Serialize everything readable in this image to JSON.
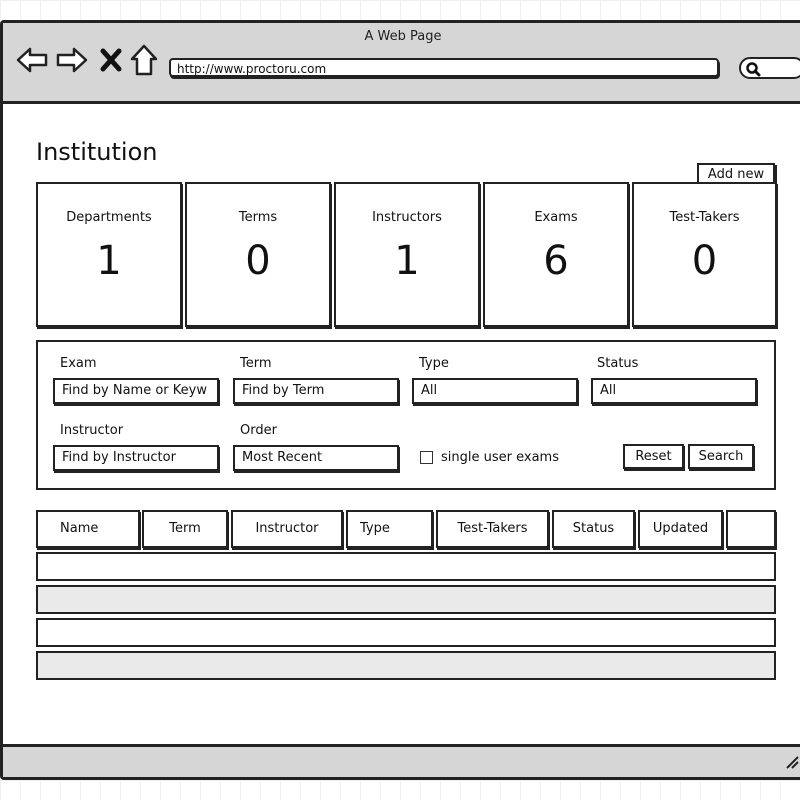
{
  "window": {
    "title": "A Web Page",
    "url": "http://www.proctoru.com"
  },
  "icons": [
    "back-arrow-icon",
    "forward-arrow-icon",
    "close-icon",
    "home-icon",
    "search-icon",
    "resize-grip-icon"
  ],
  "page": {
    "title": "Institution",
    "add_button": "Add new"
  },
  "stats": [
    {
      "label": "Departments",
      "value": "1"
    },
    {
      "label": "Terms",
      "value": "0"
    },
    {
      "label": "Instructors",
      "value": "1"
    },
    {
      "label": "Exams",
      "value": "6"
    },
    {
      "label": "Test-Takers",
      "value": "0"
    }
  ],
  "filters": {
    "exam": {
      "label": "Exam",
      "value": "Find by Name or Keyw"
    },
    "term": {
      "label": "Term",
      "value": "Find by Term"
    },
    "type": {
      "label": "Type",
      "value": "All"
    },
    "status": {
      "label": "Status",
      "value": "All"
    },
    "instructor": {
      "label": "Instructor",
      "value": "Find by Instructor"
    },
    "order": {
      "label": "Order",
      "value": "Most Recent"
    },
    "single_user_label": "single user exams",
    "reset_label": "Reset",
    "search_label": "Search"
  },
  "table": {
    "columns": [
      "Name",
      "Term",
      "Instructor",
      "Type",
      "Test-Takers",
      "Status",
      "Updated",
      ""
    ],
    "row_colors": [
      "#ffffff",
      "#eaeaea",
      "#ffffff",
      "#eaeaea"
    ]
  }
}
